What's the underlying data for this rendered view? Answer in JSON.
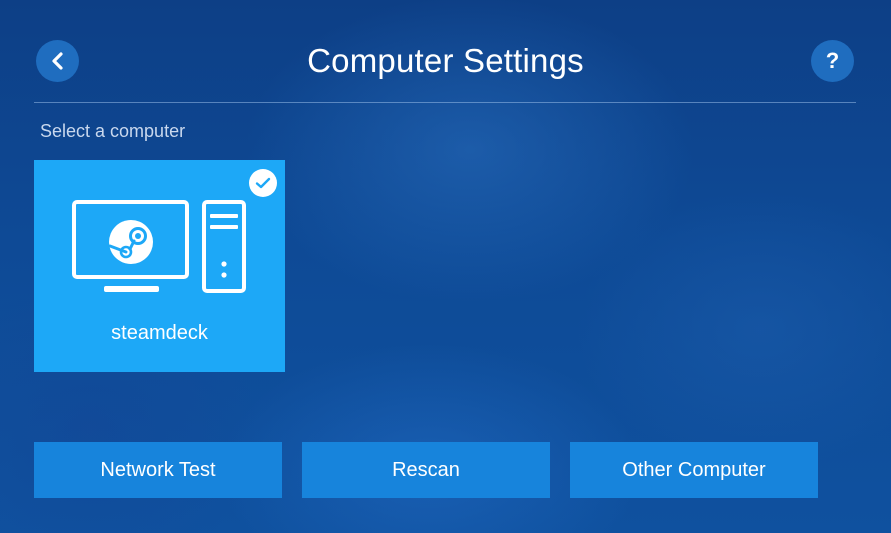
{
  "header": {
    "title": "Computer Settings",
    "back_icon": "chevron-left-icon",
    "help_label": "?"
  },
  "section": {
    "label": "Select a computer"
  },
  "computers": [
    {
      "name": "steamdeck",
      "selected": true,
      "icon": "desktop-pc-steam-icon"
    }
  ],
  "actions": {
    "network_test": "Network Test",
    "rescan": "Rescan",
    "other_computer": "Other Computer"
  },
  "colors": {
    "tile_selected": "#1da8f7",
    "action_button": "#1784dc",
    "round_button": "#1f6dbf",
    "background": "#0e4a96"
  }
}
